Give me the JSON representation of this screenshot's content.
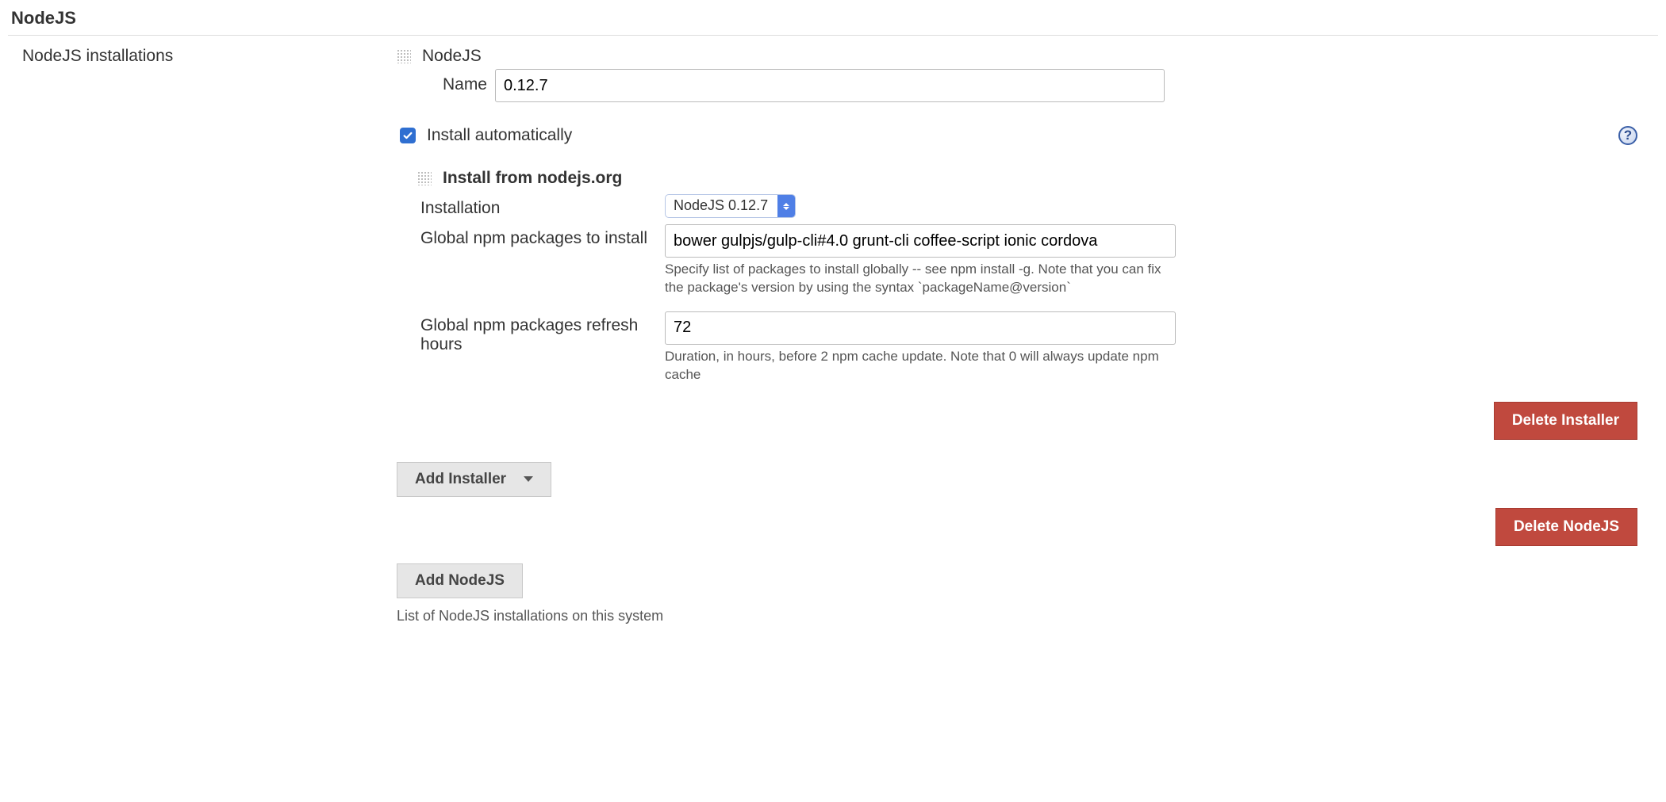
{
  "section": {
    "title": "NodeJS"
  },
  "left": {
    "installations_label": "NodeJS installations"
  },
  "entry": {
    "heading": "NodeJS",
    "name_label": "Name",
    "name_value": "0.12.7",
    "install_auto_label": "Install automatically",
    "install_auto_checked": true
  },
  "installer": {
    "heading": "Install from nodejs.org",
    "installation_label": "Installation",
    "installation_selected": "NodeJS 0.12.7",
    "packages_label": "Global npm packages to install",
    "packages_value": "bower gulpjs/gulp-cli#4.0 grunt-cli coffee-script ionic cordova",
    "packages_help": "Specify list of packages to install globally -- see npm install -g. Note that you can fix the package's version by using the syntax `packageName@version`",
    "refresh_label": "Global npm packages refresh hours",
    "refresh_value": "72",
    "refresh_help": "Duration, in hours, before 2 npm cache update. Note that 0 will always update npm cache"
  },
  "buttons": {
    "delete_installer": "Delete Installer",
    "add_installer": "Add Installer",
    "delete_nodejs": "Delete NodeJS",
    "add_nodejs": "Add NodeJS"
  },
  "footer": {
    "note": "List of NodeJS installations on this system"
  }
}
